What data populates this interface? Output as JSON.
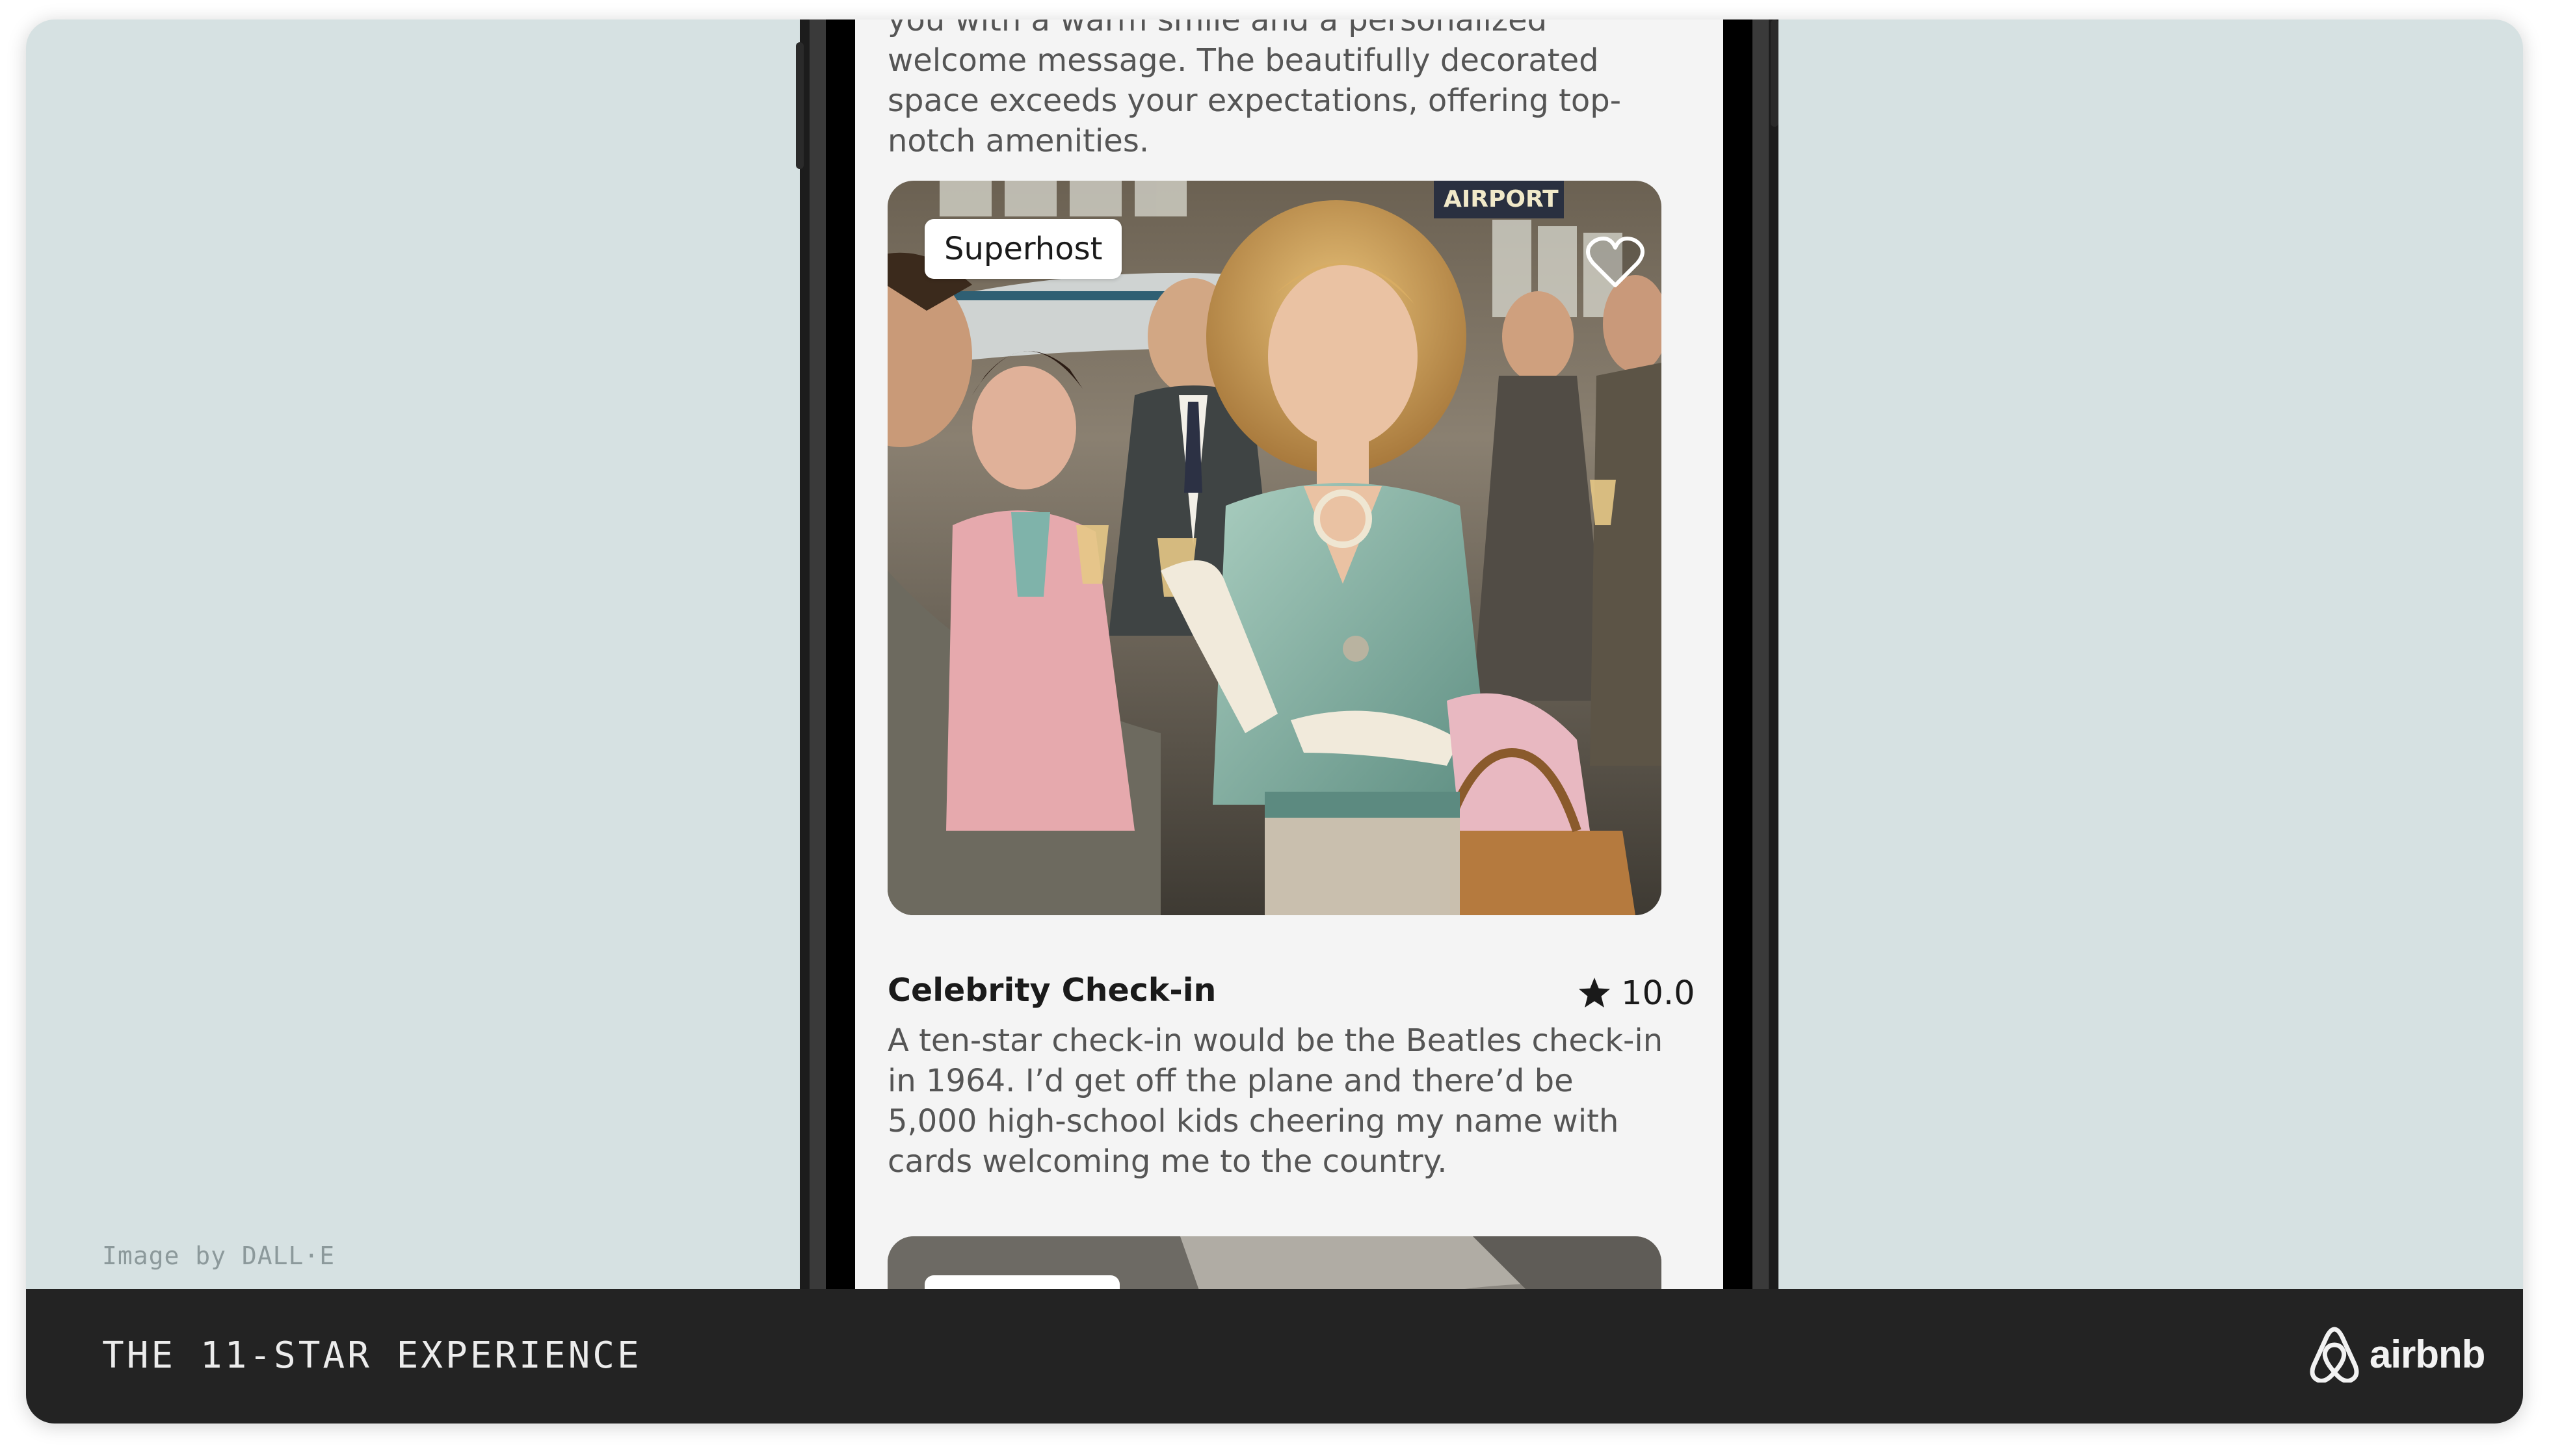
{
  "credit": "Image by DALL·E",
  "intro": {
    "text": "you with a warm smile and a personalized welcome message. The beautifully decorated space exceeds your expectations, offering top-notch amenities."
  },
  "card": {
    "badge": "Superhost",
    "photo_sign": "AIRPORT",
    "title": "Celebrity Check-in",
    "rating": "10.0",
    "description": "A ten-star check-in would be the Beatles check-in in 1964. I’d get off the plane and there’d be 5,000 high-school kids cheering my name with cards welcoming me to the country."
  },
  "footer": {
    "title": "THE 11-STAR EXPERIENCE",
    "brand": "airbnb"
  },
  "colors": {
    "background": "#d6e1e2",
    "footer": "#232323",
    "screen": "#f4f4f4",
    "text": "#555555"
  },
  "icons": [
    "heart-icon",
    "star-icon",
    "airbnb-logo-icon"
  ]
}
